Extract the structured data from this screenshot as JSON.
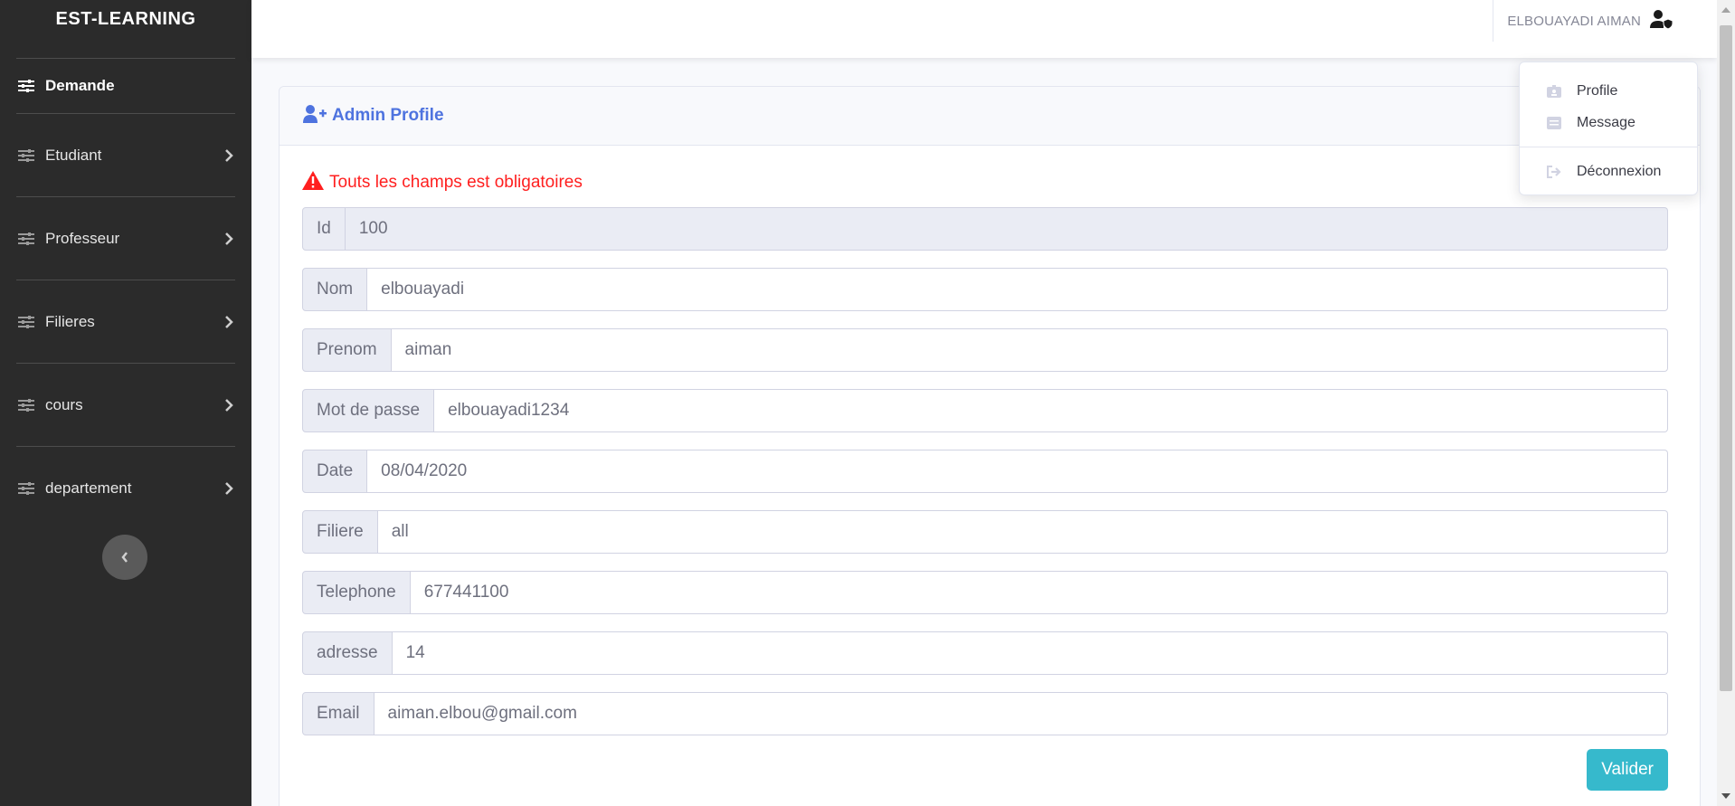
{
  "sidebar": {
    "brand": "EST-LEARNING",
    "items": [
      {
        "label": "Demande"
      },
      {
        "label": "Etudiant"
      },
      {
        "label": "Professeur"
      },
      {
        "label": "Filieres"
      },
      {
        "label": "cours"
      },
      {
        "label": "departement"
      }
    ]
  },
  "topbar": {
    "user_name": "ELBOUAYADI AIMAN"
  },
  "user_menu": {
    "items": [
      {
        "label": "Profile",
        "icon": "id-badge-icon"
      },
      {
        "label": "Message",
        "icon": "envelope-icon"
      },
      {
        "label": "Déconnexion",
        "icon": "sign-out-icon"
      }
    ]
  },
  "card": {
    "title": "Admin Profile",
    "alert": "Touts les champs est obligatoires",
    "fields": [
      {
        "label": "Id",
        "value": "100",
        "readonly": true
      },
      {
        "label": "Nom",
        "value": "elbouayadi"
      },
      {
        "label": "Prenom",
        "value": "aiman"
      },
      {
        "label": "Mot de passe",
        "value": "elbouayadi1234"
      },
      {
        "label": "Date",
        "value": "08/04/2020"
      },
      {
        "label": "Filiere",
        "value": "all"
      },
      {
        "label": "Telephone",
        "value": "677441100"
      },
      {
        "label": "adresse",
        "value": "14"
      },
      {
        "label": "Email",
        "value": "aiman.elbou@gmail.com"
      }
    ],
    "submit_label": "Valider"
  },
  "colors": {
    "sidebar_bg": "#2b2b2b",
    "primary": "#4e73df",
    "danger": "#ff1f1f",
    "info": "#36b9cc"
  }
}
